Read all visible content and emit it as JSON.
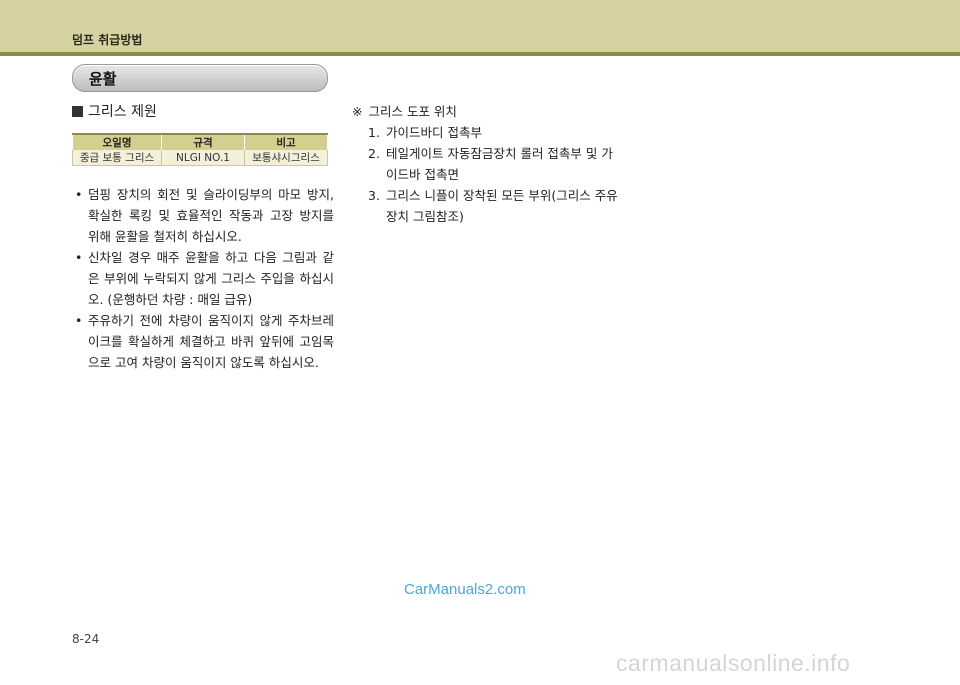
{
  "header": {
    "title": "덤프 취급방법"
  },
  "section": {
    "title": "윤활"
  },
  "sub_heading": {
    "marker": "■",
    "text": "그리스 제원"
  },
  "spec_table": {
    "headers": [
      "오일명",
      "규격",
      "비고"
    ],
    "rows": [
      [
        "중급 보통 그리스",
        "NLGI NO.1",
        "보통샤시그리스"
      ]
    ]
  },
  "bullets": [
    "덤핑 장치의 회전 및 슬라이딩부의 마모 방지, 확실한 록킹 및 효율적인 작동과 고장 방지를 위해 윤활을 철저히 하십시오.",
    "신차일 경우 매주 윤활을 하고 다음 그림과 같은 부위에 누락되지 않게 그리스 주입을 하십시오. (운행하던 차량 : 매일 급유)",
    "주유하기 전에 차량이 움직이지 않게 주차브레이크를 확실하게 체결하고 바퀴 앞뒤에 고임목으로 고여 차량이 움직이지 않도록 하십시오."
  ],
  "bullet_marker": "•",
  "notes": {
    "mark": "※",
    "title": "그리스 도포 위치",
    "items": [
      {
        "num": "1.",
        "text": "가이드바디 접촉부"
      },
      {
        "num": "2.",
        "text": "테일게이트 자동잠금장치 롤러 접촉부 및 가이드바 접촉면"
      },
      {
        "num": "3.",
        "text": "그리스 니플이 장착된 모든 부위(그리스 주유장치 그림참조)"
      }
    ]
  },
  "watermark": "CarManuals2.com",
  "page_number": "8-24",
  "footer_watermark": "carmanualsonline.info"
}
